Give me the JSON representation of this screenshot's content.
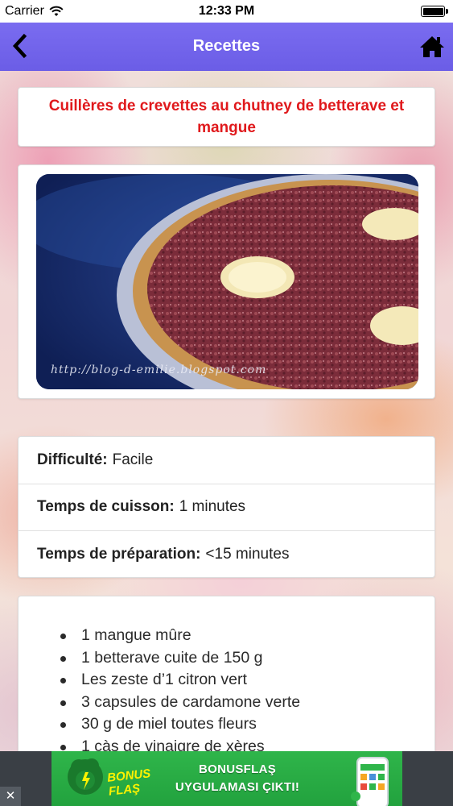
{
  "status_bar": {
    "carrier": "Carrier",
    "time": "12:33 PM"
  },
  "nav_bar": {
    "title": "Recettes",
    "back_icon": "chevron-left-icon",
    "home_icon": "home-icon"
  },
  "recipe": {
    "title": "Cuillères de crevettes au chutney de betterave et mangue",
    "title_color": "#e0191c",
    "image_watermark": "http://blog-d-emilie.blogspot.com"
  },
  "info": [
    {
      "label": "Difficulté:",
      "value": "Facile"
    },
    {
      "label": "Temps de cuisson:",
      "value": "1 minutes"
    },
    {
      "label": "Temps de préparation:",
      "value": "<15 minutes"
    }
  ],
  "ingredients": [
    "1 mangue mûre",
    "1 betterave cuite de 150 g",
    "Les zeste d’1 citron vert",
    "3 capsules de cardamone verte",
    "30 g de miel toutes fleurs",
    "1 càs de vinaigre de xères"
  ],
  "ad": {
    "close_label": "✕",
    "logo_text_1": "BONUS",
    "logo_text_2": "FLAŞ",
    "line1": "BONUSFLAŞ",
    "line2": "UYGULAMASI ÇIKTI!",
    "brand_color": "#2fb54a"
  },
  "colors": {
    "nav_bar": "#6b5de6",
    "card": "#ffffff"
  }
}
